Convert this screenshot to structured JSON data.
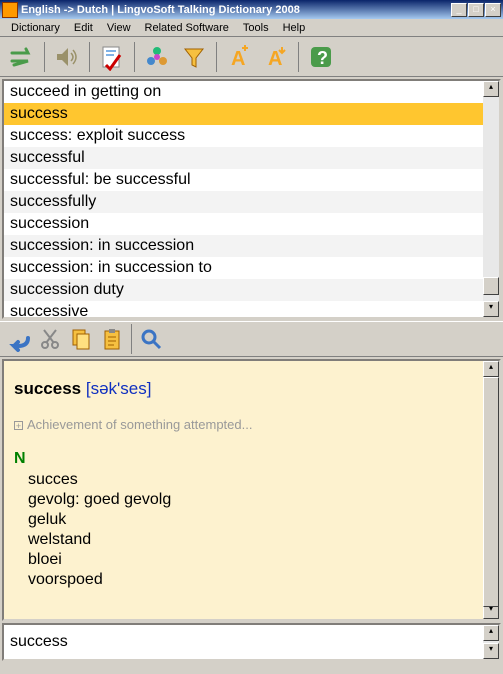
{
  "window": {
    "title": "English -> Dutch | LingvoSoft Talking Dictionary 2008"
  },
  "menubar": [
    "Dictionary",
    "Edit",
    "View",
    "Related Software",
    "Tools",
    "Help"
  ],
  "toolbar_icons": [
    "reverse",
    "speak",
    "spellcheck",
    "synonyms",
    "filter",
    "aligna",
    "alignb",
    "help"
  ],
  "wordlist": {
    "items": [
      {
        "text": "succeed in getting on",
        "selected": false
      },
      {
        "text": "success",
        "selected": true
      },
      {
        "text": "success: exploit success",
        "selected": false
      },
      {
        "text": "successful",
        "selected": false
      },
      {
        "text": "successful: be successful",
        "selected": false
      },
      {
        "text": "successfully",
        "selected": false
      },
      {
        "text": "succession",
        "selected": false
      },
      {
        "text": "succession: in succession",
        "selected": false
      },
      {
        "text": "succession: in succession to",
        "selected": false
      },
      {
        "text": "succession duty",
        "selected": false
      },
      {
        "text": "successive",
        "selected": false
      }
    ]
  },
  "toolbar2_icons": [
    "back",
    "cut",
    "copy",
    "paste",
    "search"
  ],
  "definition": {
    "headword": "success",
    "pronunciation": "[sək'ses]",
    "gloss": "Achievement of something attempted...",
    "pos": "N",
    "translations": [
      "succes",
      "gevolg: goed gevolg",
      "geluk",
      "welstand",
      "bloei",
      "voorspoed"
    ]
  },
  "search": {
    "value": "success"
  }
}
